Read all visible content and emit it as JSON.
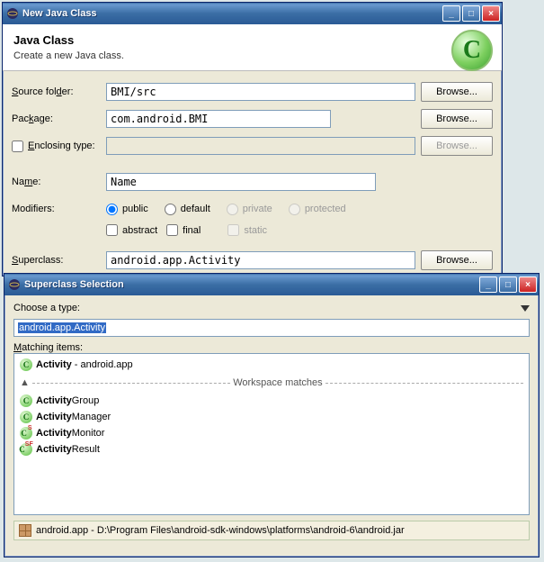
{
  "win1": {
    "title": "New Java Class",
    "header_title": "Java Class",
    "header_sub": "Create a new Java class.",
    "fields": {
      "source_folder_label": "Source folder:",
      "source_folder_value": "BMI/src",
      "package_label": "Package:",
      "package_value": "com.android.BMI",
      "enclosing_label": "Enclosing type:",
      "enclosing_value": "",
      "name_label": "Name:",
      "name_value": "Name",
      "modifiers_label": "Modifiers:",
      "superclass_label": "Superclass:",
      "superclass_value": "android.app.Activity"
    },
    "modifiers": {
      "public": "public",
      "default": "default",
      "private": "private",
      "protected": "protected",
      "abstract": "abstract",
      "final": "final",
      "static": "static"
    },
    "browse": "Browse..."
  },
  "win2": {
    "title": "Superclass Selection",
    "choose_label": "Choose a type:",
    "search_value": "android.app.Activity",
    "matching_label": "Matching items:",
    "workspace_sep": "Workspace matches",
    "items": [
      {
        "bold": "Activity",
        "rest": " - android.app"
      },
      {
        "bold": "Activity",
        "rest": "Group"
      },
      {
        "bold": "Activity",
        "rest": "Manager"
      },
      {
        "bold": "Activity",
        "rest": "Monitor"
      },
      {
        "bold": "Activity",
        "rest": "Result"
      }
    ],
    "footer": "android.app - D:\\Program Files\\android-sdk-windows\\platforms\\android-6\\android.jar"
  }
}
